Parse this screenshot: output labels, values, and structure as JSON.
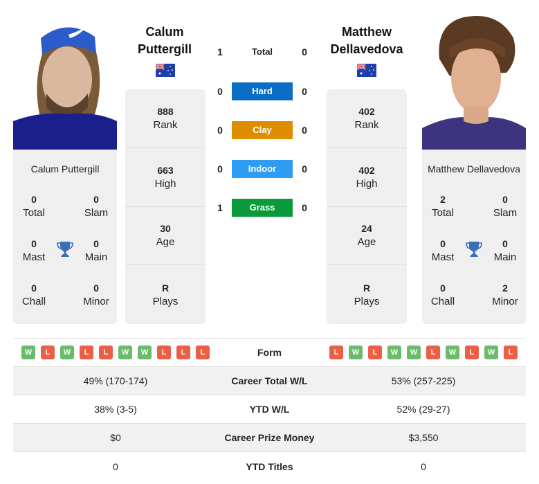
{
  "players": [
    {
      "name": "Calum Puttergill",
      "name_line1": "Calum",
      "name_line2": "Puttergill",
      "country": "Australia",
      "info": [
        {
          "value": "888",
          "label": "Rank"
        },
        {
          "value": "663",
          "label": "High"
        },
        {
          "value": "30",
          "label": "Age"
        },
        {
          "value": "R",
          "label": "Plays"
        }
      ],
      "titles": {
        "total": {
          "value": "0",
          "label": "Total"
        },
        "slam": {
          "value": "0",
          "label": "Slam"
        },
        "mast": {
          "value": "0",
          "label": "Mast"
        },
        "main": {
          "value": "0",
          "label": "Main"
        },
        "chall": {
          "value": "0",
          "label": "Chall"
        },
        "minor": {
          "value": "0",
          "label": "Minor"
        }
      },
      "form": [
        "W",
        "L",
        "W",
        "L",
        "L",
        "W",
        "W",
        "L",
        "L",
        "L"
      ]
    },
    {
      "name": "Matthew Dellavedova",
      "name_line1": "Matthew",
      "name_line2": "Dellavedova",
      "country": "Australia",
      "info": [
        {
          "value": "402",
          "label": "Rank"
        },
        {
          "value": "402",
          "label": "High"
        },
        {
          "value": "24",
          "label": "Age"
        },
        {
          "value": "R",
          "label": "Plays"
        }
      ],
      "titles": {
        "total": {
          "value": "2",
          "label": "Total"
        },
        "slam": {
          "value": "0",
          "label": "Slam"
        },
        "mast": {
          "value": "0",
          "label": "Mast"
        },
        "main": {
          "value": "0",
          "label": "Main"
        },
        "chall": {
          "value": "0",
          "label": "Chall"
        },
        "minor": {
          "value": "2",
          "label": "Minor"
        }
      },
      "form": [
        "L",
        "W",
        "L",
        "W",
        "W",
        "L",
        "W",
        "L",
        "W",
        "L"
      ]
    }
  ],
  "h2h": [
    {
      "label": "Total",
      "left": "1",
      "right": "0",
      "color": ""
    },
    {
      "label": "Hard",
      "left": "0",
      "right": "0",
      "color": "#0a6ec4"
    },
    {
      "label": "Clay",
      "left": "0",
      "right": "0",
      "color": "#de8d00"
    },
    {
      "label": "Indoor",
      "left": "0",
      "right": "0",
      "color": "#2e9cf3"
    },
    {
      "label": "Grass",
      "left": "1",
      "right": "0",
      "color": "#0b9a3a"
    }
  ],
  "stats": {
    "form_label": "Form",
    "rows": [
      {
        "label": "Career Total W/L",
        "left": "49% (170-174)",
        "right": "53% (257-225)"
      },
      {
        "label": "YTD W/L",
        "left": "38% (3-5)",
        "right": "52% (29-27)"
      },
      {
        "label": "Career Prize Money",
        "left": "$0",
        "right": "$3,550"
      },
      {
        "label": "YTD Titles",
        "left": "0",
        "right": "0"
      }
    ]
  },
  "colors": {
    "win": "#6cba6c",
    "loss": "#ec5f47",
    "trophy": "#3a6fb8",
    "card_bg": "#efefef"
  }
}
